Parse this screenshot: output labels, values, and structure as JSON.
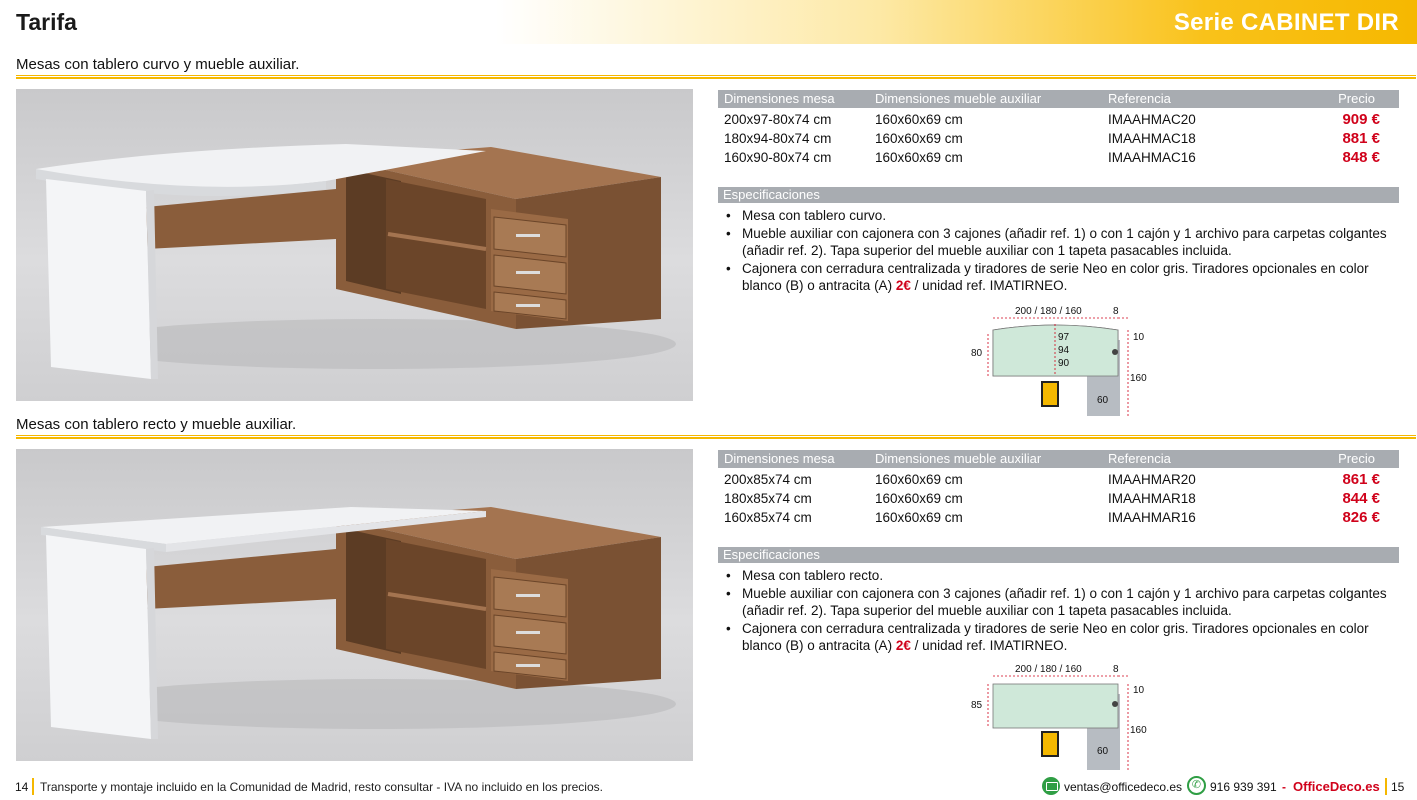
{
  "header": {
    "title": "Tarifa",
    "series": "Serie CABINET DIR"
  },
  "sections": [
    {
      "title": "Mesas con tablero curvo y mueble auxiliar.",
      "table": {
        "headers": [
          "Dimensiones mesa",
          "Dimensiones mueble auxiliar",
          "Referencia",
          "Precio"
        ],
        "rows": [
          [
            "200x97-80x74 cm",
            "160x60x69 cm",
            "IMAAHMAC20",
            "909 €"
          ],
          [
            "180x94-80x74 cm",
            "160x60x69 cm",
            "IMAAHMAC18",
            "881 €"
          ],
          [
            "160x90-80x74 cm",
            "160x60x69 cm",
            "IMAAHMAC16",
            "848 €"
          ]
        ]
      },
      "specs_title": "Especificaciones",
      "specs": [
        {
          "text": "Mesa con tablero curvo."
        },
        {
          "text": "Mueble auxiliar con cajonera con 3 cajones (añadir ref. 1) o con 1 cajón y 1 archivo para carpetas colgantes (añadir ref. 2). Tapa superior del mueble auxiliar con 1 tapeta pasacables incluida."
        },
        {
          "pre": "Cajonera con cerradura centralizada y tiradores de serie Neo en color gris. Tiradores opcionales en color blanco (B) o antracita (A) ",
          "highlight": "2€",
          "post": " / unidad ref. IMATIRNEO."
        }
      ],
      "diagram": {
        "width": "200 / 180 / 160",
        "gap": "8",
        "depth": "80",
        "depths": [
          "97",
          "94",
          "90"
        ],
        "top": "10",
        "aux_len": "160",
        "aux_w": "60"
      }
    },
    {
      "title": "Mesas con tablero recto y mueble auxiliar.",
      "table": {
        "headers": [
          "Dimensiones mesa",
          "Dimensiones mueble auxiliar",
          "Referencia",
          "Precio"
        ],
        "rows": [
          [
            "200x85x74 cm",
            "160x60x69 cm",
            "IMAAHMAR20",
            "861 €"
          ],
          [
            "180x85x74 cm",
            "160x60x69 cm",
            "IMAAHMAR18",
            "844 €"
          ],
          [
            "160x85x74 cm",
            "160x60x69 cm",
            "IMAAHMAR16",
            "826 €"
          ]
        ]
      },
      "specs_title": "Especificaciones",
      "specs": [
        {
          "text": "Mesa con tablero recto."
        },
        {
          "text": "Mueble auxiliar con cajonera con 3 cajones (añadir ref. 1) o con 1 cajón y 1 archivo para carpetas colgantes (añadir ref. 2). Tapa superior del mueble auxiliar con 1 tapeta pasacables incluida."
        },
        {
          "pre": "Cajonera con cerradura centralizada y tiradores de serie Neo en color gris. Tiradores opcionales en color blanco (B) o antracita (A) ",
          "highlight": "2€",
          "post": " / unidad ref. IMATIRNEO."
        }
      ],
      "diagram": {
        "width": "200 / 180 / 160",
        "gap": "8",
        "depth": "85",
        "top": "10",
        "aux_len": "160",
        "aux_w": "60"
      }
    }
  ],
  "footer": {
    "page_left": "14",
    "note": "Transporte y montaje incluido en la Comunidad de Madrid, resto consultar - IVA no incluido en los precios.",
    "email": "ventas@officedeco.es",
    "phone": "916 939 391",
    "separator": "-",
    "brand": "OfficeDeco.es",
    "page_right": "15"
  },
  "colors": {
    "accent": "#f5b800",
    "price": "#d0021b",
    "table_header": "#a8acb1",
    "wood": "#8a5d3b",
    "icon_green": "#2f9e44"
  }
}
